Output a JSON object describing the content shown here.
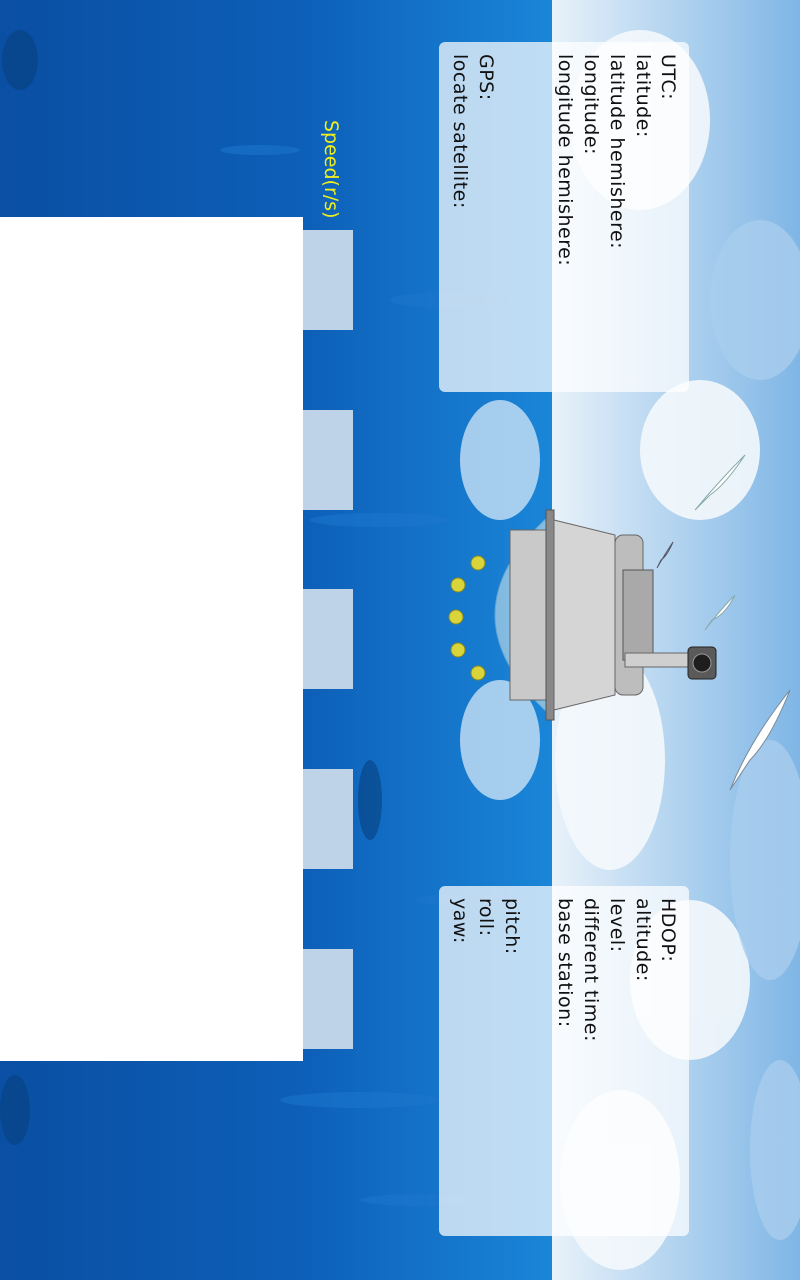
{
  "gps_panel": {
    "labels": [
      "UTC:",
      "latitude:",
      "latitude hemishere:",
      "longitude:",
      "longitude hemishere:",
      "GPS:",
      "locate satellite:"
    ]
  },
  "attitude_panel": {
    "labels": [
      "HDOP:",
      "altitude:",
      "level:",
      "different time:",
      "base station:",
      "pitch:",
      "roll:",
      "yaw:"
    ]
  },
  "speed": {
    "label": "Speed(r/s)",
    "boxes": [
      "",
      "",
      "",
      "",
      ""
    ]
  },
  "colors": {
    "sea": "#0b55a8",
    "sky": "#cfe3f5",
    "speed_label": "#f2ef1a",
    "panel": "#ffffff",
    "propeller": "#d8d43a"
  },
  "icons": {
    "vehicle": "underwater-vehicle-icon",
    "gull": "seagull-icon"
  }
}
